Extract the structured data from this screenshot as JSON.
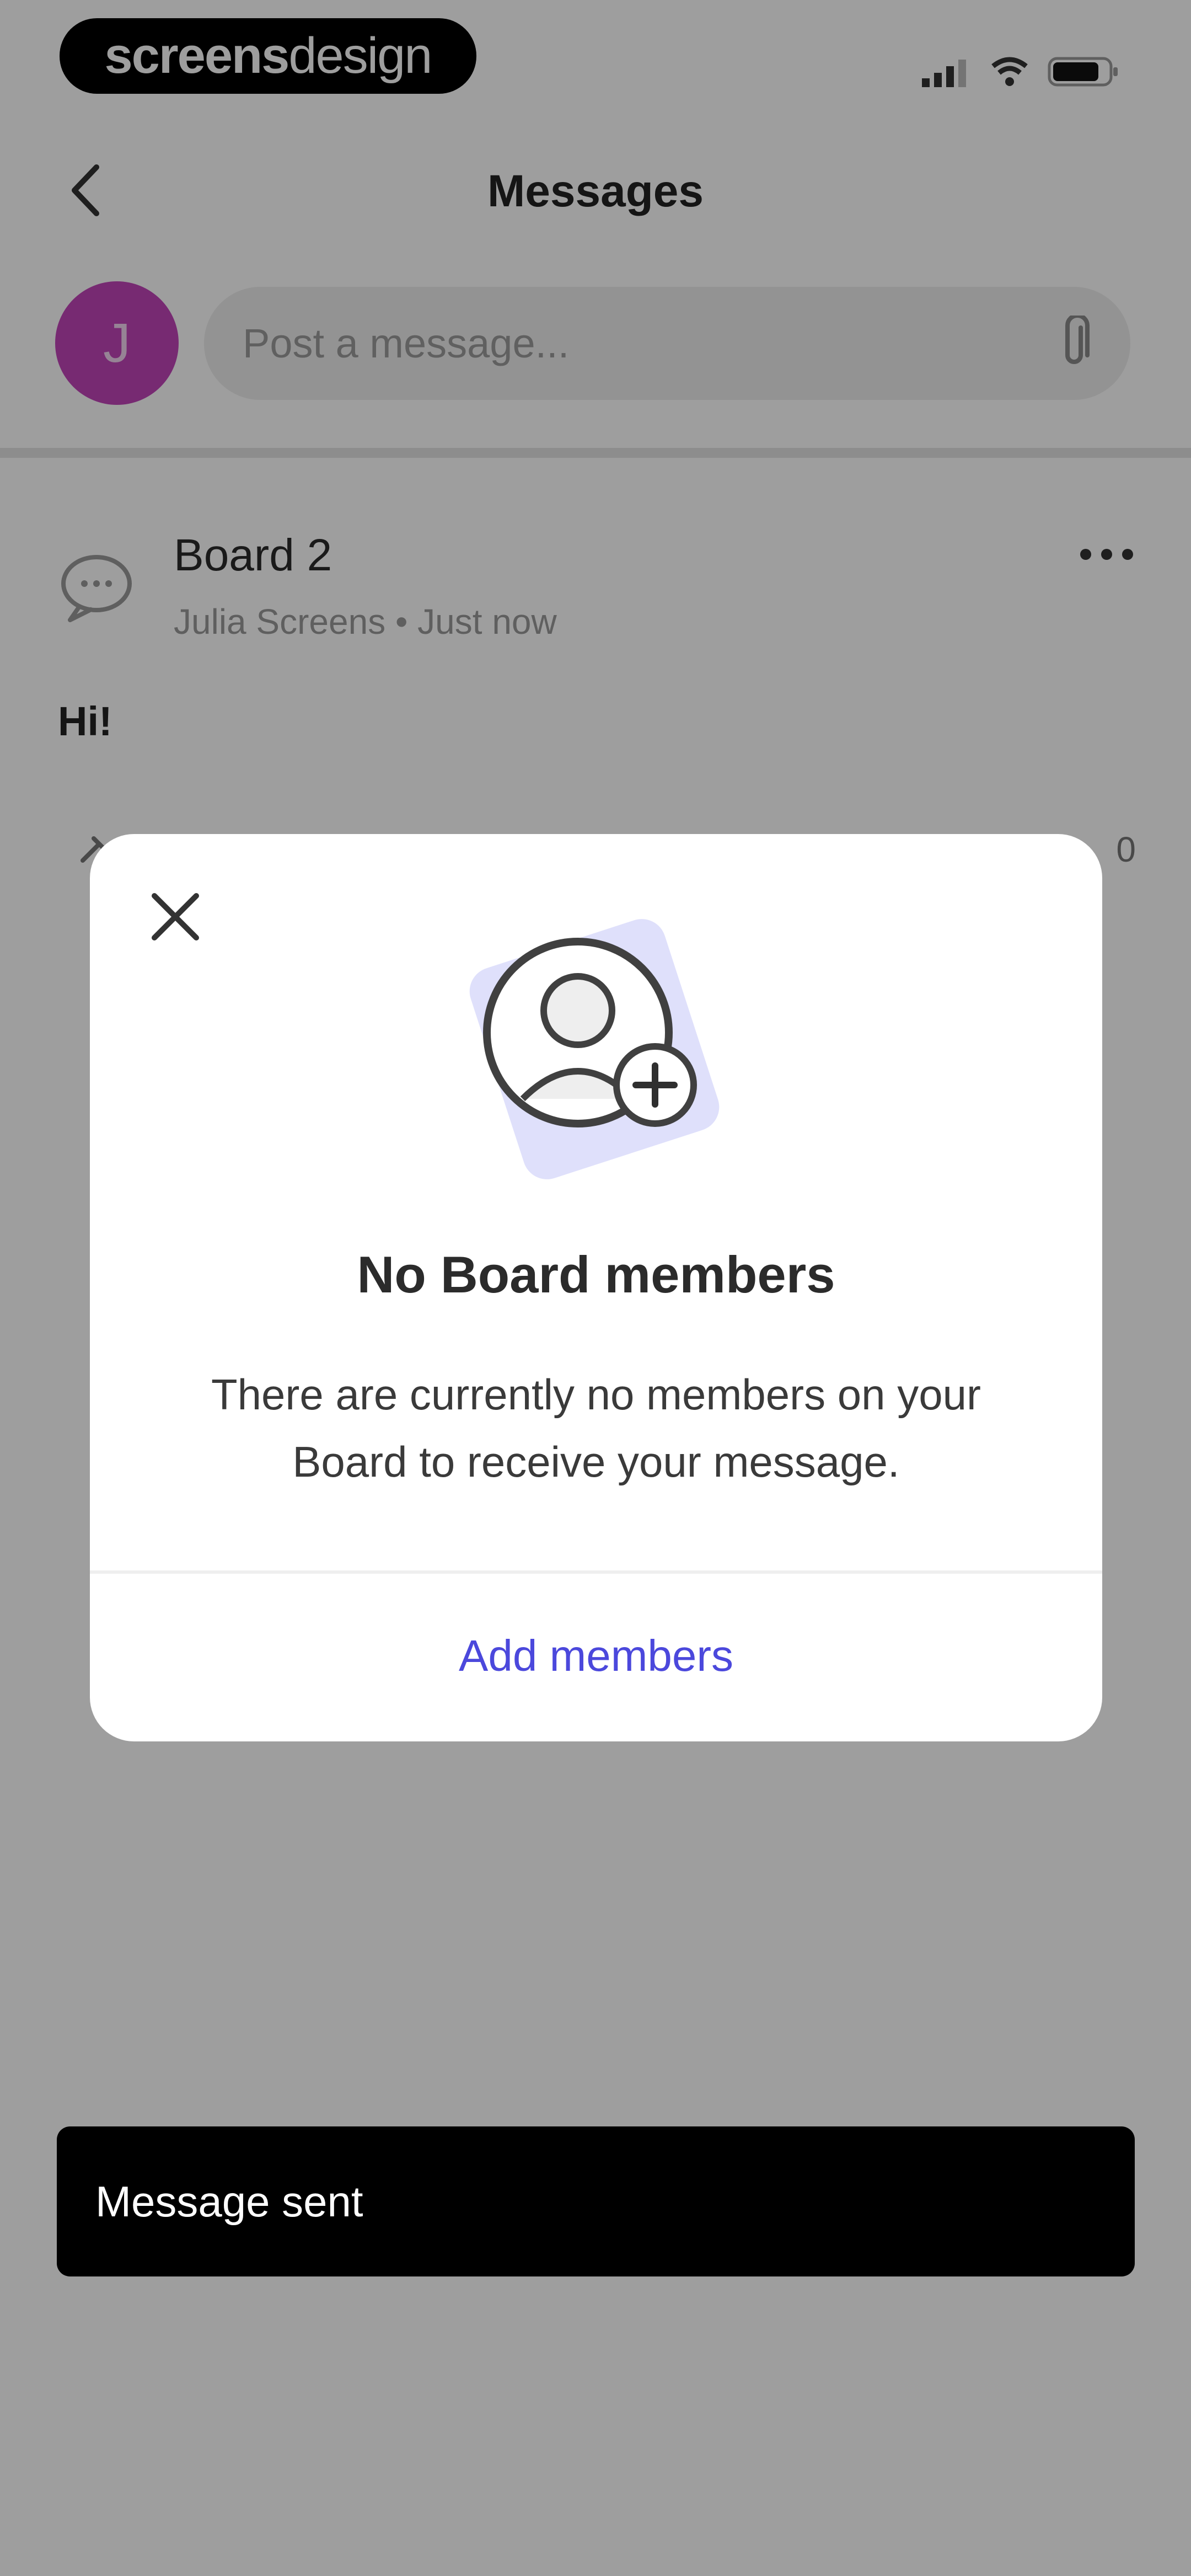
{
  "brand": {
    "bold": "screens",
    "light": "design"
  },
  "header": {
    "title": "Messages"
  },
  "composer": {
    "avatar_initial": "J",
    "placeholder": "Post a message..."
  },
  "post": {
    "title": "Board 2",
    "meta": "Julia Screens • Just now",
    "body": "Hi!",
    "count": "0"
  },
  "modal": {
    "heading": "No Board members",
    "text": "There are currently no members on your Board to receive your message.",
    "action": "Add members",
    "accent_color": "#4b48dc"
  },
  "toast": {
    "text": "Message sent"
  },
  "icons": [
    "back-chevron-icon",
    "paperclip-icon",
    "comment-icon",
    "more-icon",
    "close-icon",
    "add-user-icon"
  ]
}
